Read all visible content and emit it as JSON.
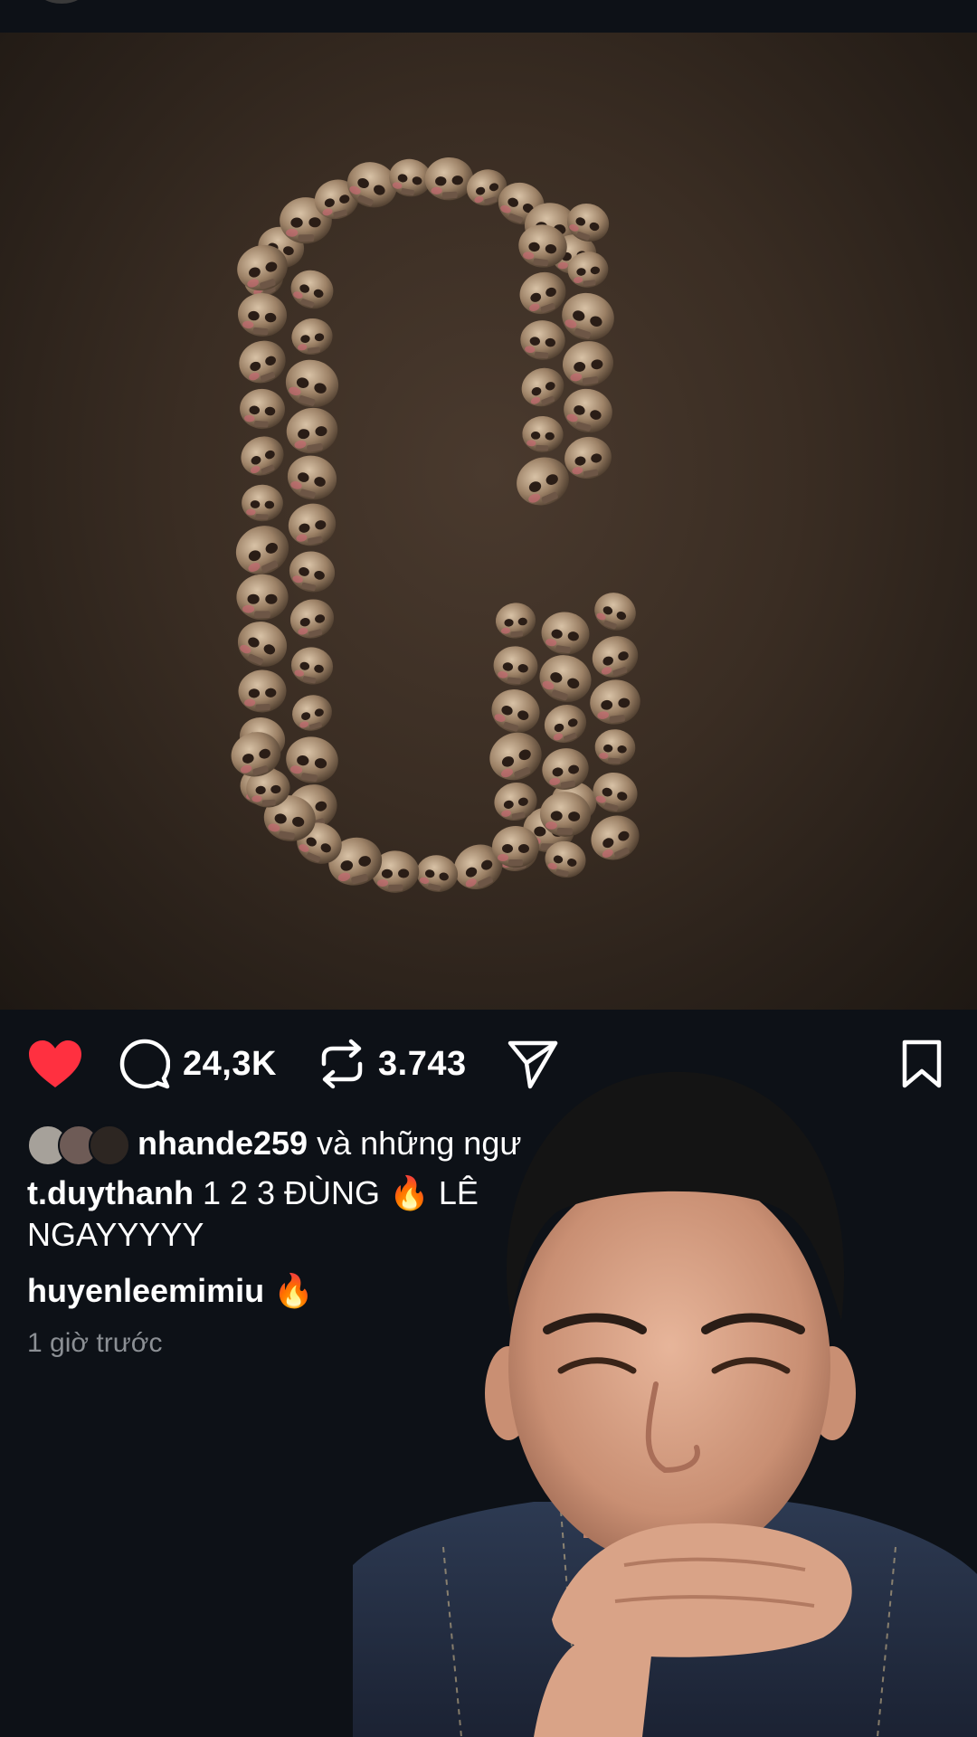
{
  "post": {
    "actions": {
      "comment_count": "24,3K",
      "repost_count": "3.743"
    },
    "likes": {
      "first_user": "nhande259",
      "connector": " và những ngư"
    },
    "caption": {
      "username": "t.duythanh",
      "text_before": " 1 2 3 ĐÙNG ",
      "emoji": "🔥",
      "text_after": " LÊ",
      "continuation": "NGAYYYYY"
    },
    "comment": {
      "username": "huyenleemimiu",
      "emoji": "🔥"
    },
    "timestamp": "1 giờ trước"
  },
  "colors": {
    "background": "#0d1117",
    "like_active": "#ff3040",
    "muted_text": "#8b8f94"
  },
  "icons": [
    "heart-icon",
    "comment-icon",
    "repost-icon",
    "share-icon",
    "bookmark-icon",
    "fire-emoji"
  ]
}
